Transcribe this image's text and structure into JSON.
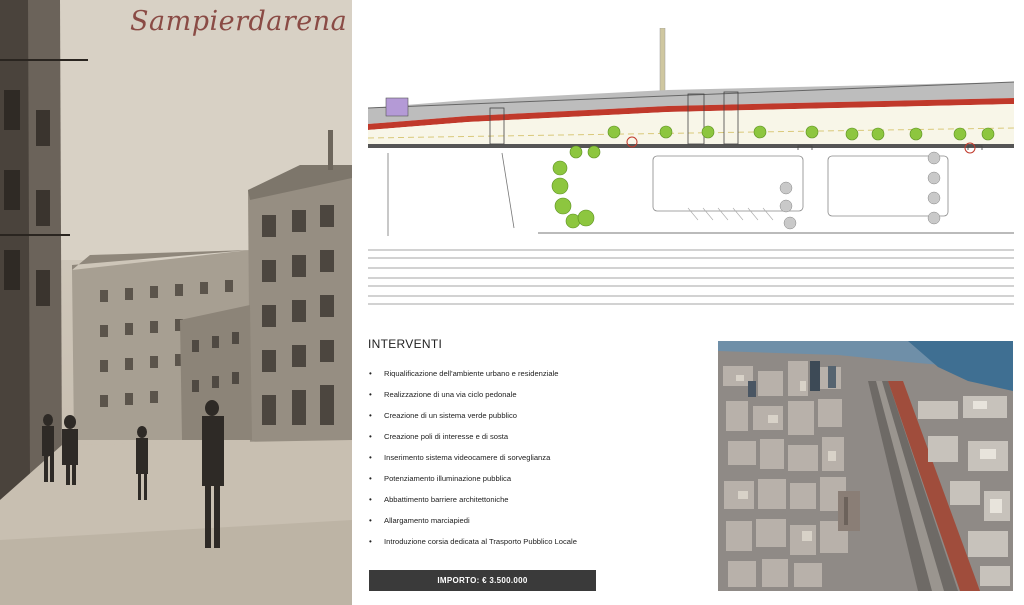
{
  "postcard": {
    "title": "Sampierdarena",
    "image": "vintage-street-photo"
  },
  "plan": {
    "image": "urban-redevelopment-site-plan",
    "colors": {
      "trees": "#8dc63f",
      "bike_lane": "#c0392b",
      "building_block": "#b49ad6",
      "road_edge": "#555555"
    }
  },
  "interventions": {
    "heading": "INTERVENTI",
    "bullet": "•",
    "items": [
      "Riqualificazione dell'ambiente urbano e residenziale",
      "Realizzazione di una via ciclo pedonale",
      "Creazione di un sistema verde pubblico",
      "Creazione poli di interesse e di sosta",
      "Inserimento sistema videocamere di sorveglianza",
      "Potenziamento illuminazione pubblica",
      "Abbattimento barriere architettoniche",
      "Allargamento marciapiedi",
      "Introduzione corsia dedicata al Trasporto Pubblico Locale"
    ]
  },
  "importo": {
    "label": "IMPORTO: € 3.500.000",
    "background": "#3a3a3a"
  },
  "aerial": {
    "image": "aerial-city-photo"
  }
}
